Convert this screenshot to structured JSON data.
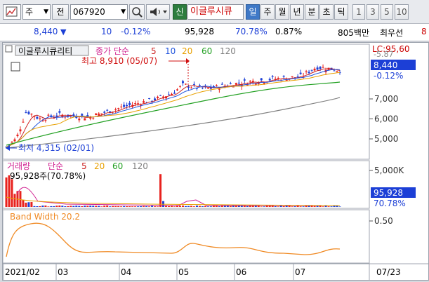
{
  "toolbar": {
    "market_select": "주",
    "dropdown_arrow": "▼",
    "market_label": "전",
    "code": "067920",
    "new_label": "신",
    "stock_name": "이글루시큐",
    "periods": [
      "일",
      "주",
      "월",
      "년",
      "분",
      "초",
      "틱"
    ],
    "active_period": "일",
    "intervals": [
      "1",
      "3",
      "5",
      "10"
    ]
  },
  "quote": {
    "price": "8,440",
    "direction_arrow": "▼",
    "change": "10",
    "change_pct": "-0.12%",
    "volume": "95,928",
    "volume_ratio": "70.78%",
    "turnover_pct": "0.87%",
    "amount": "805백만",
    "quote_label": "최우선",
    "bid_partial": "8"
  },
  "price_panel": {
    "title": "이글루시큐리티",
    "ma_label": "종가 단순",
    "ma_periods": [
      "5",
      "10",
      "20",
      "60",
      "120"
    ],
    "ma_colors": [
      "#cc2222",
      "#2255dd",
      "#e8a000",
      "#22a022",
      "#808080"
    ],
    "high_label": "최고 8,910 (05/07)",
    "low_label": "최저 4,315 (02/01)",
    "lc_label": "LC:95,60",
    "side_label": "-5.87",
    "current_price": "8,440",
    "current_pct": "-0.12%",
    "y_ticks": [
      "7,000",
      "6,000",
      "5,000"
    ]
  },
  "volume_panel": {
    "title": "거래량",
    "ma_label": "단순",
    "ma_periods": [
      "5",
      "20",
      "60",
      "120"
    ],
    "value_label": "95,928주(70.78%)",
    "y_tick": "5,000K",
    "current_volume": "95,928",
    "current_pct": "70.78%"
  },
  "bw_panel": {
    "title": "Band Width 20.2",
    "y_tick": "0.50"
  },
  "x_axis": {
    "labels": [
      "2021/02",
      "03",
      "04",
      "05",
      "06",
      "07"
    ],
    "right_label": "07/23"
  },
  "colors": {
    "up": "#e8221e",
    "down": "#1c3fd6",
    "active_tab": "#3f79c7",
    "bw_line": "#f08a24"
  }
}
